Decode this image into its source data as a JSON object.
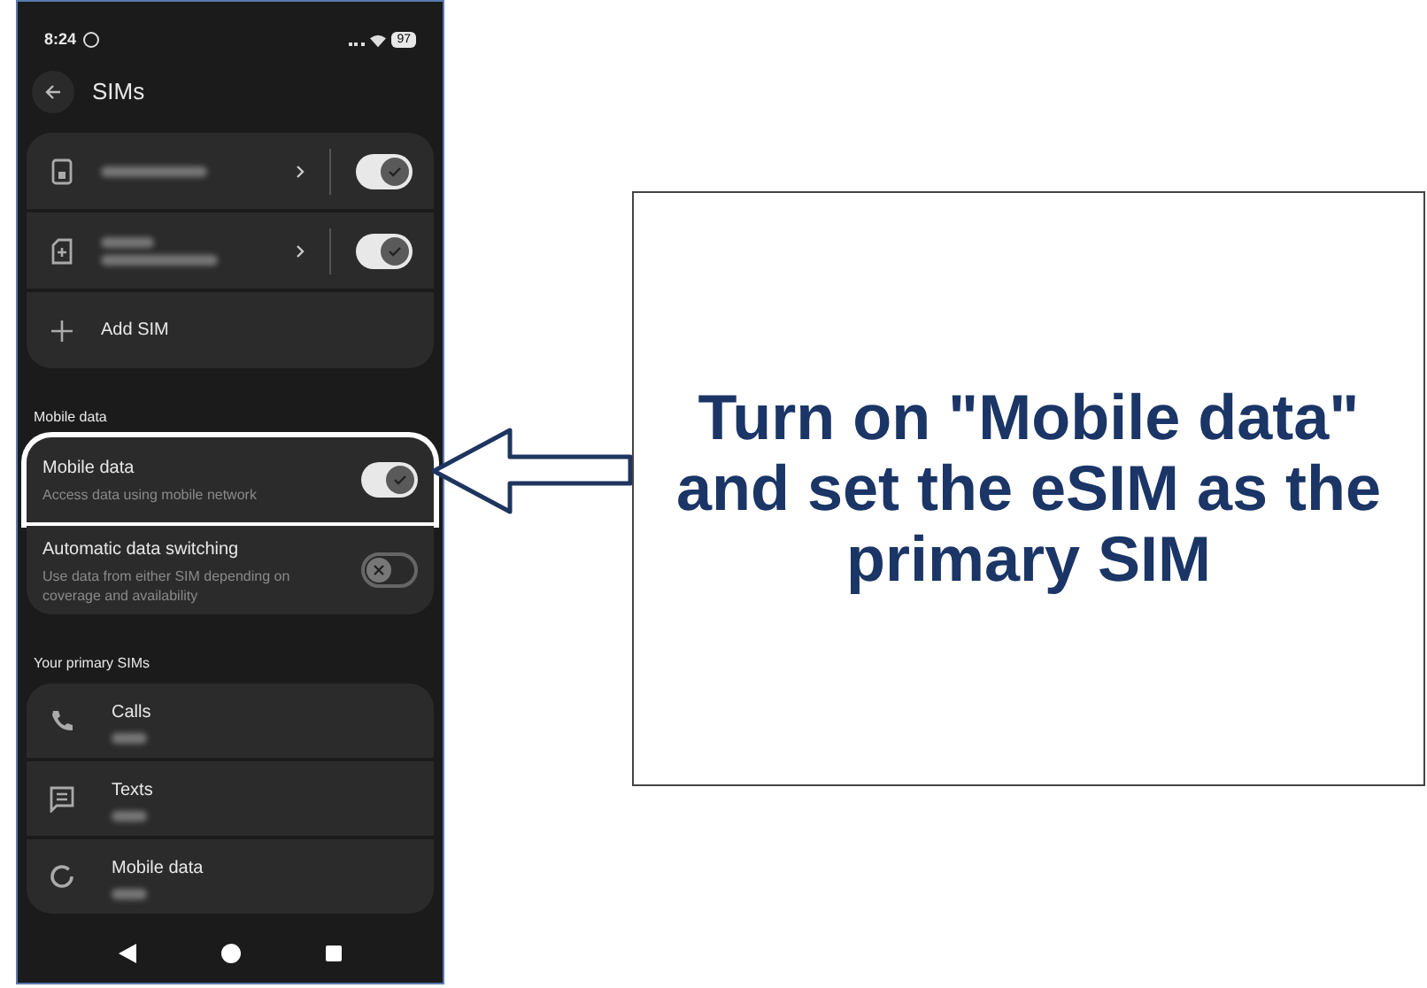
{
  "status_bar": {
    "time": "8:24",
    "battery": "97"
  },
  "header": {
    "title": "SIMs"
  },
  "sims": [
    {
      "kind": "physical",
      "on": true,
      "subtitle": false
    },
    {
      "kind": "esim",
      "on": true,
      "subtitle": true
    },
    {
      "kind": "add",
      "label": "Add SIM"
    }
  ],
  "mobile_data": {
    "heading": "Mobile data",
    "rows": [
      {
        "title": "Mobile data",
        "subtitle": "Access data using mobile network",
        "on": true,
        "highlighted": true
      },
      {
        "title": "Automatic data switching",
        "subtitle": "Use data from either SIM depending on coverage and availability",
        "on": false,
        "highlighted": false
      }
    ]
  },
  "primary_sims": {
    "heading": "Your primary SIMs",
    "items": [
      {
        "kind": "calls",
        "label": "Calls"
      },
      {
        "kind": "texts",
        "label": "Texts"
      },
      {
        "kind": "data",
        "label": "Mobile data"
      }
    ]
  },
  "callout": {
    "text": "Turn on \"Mobile data\" and set the eSIM as the primary SIM"
  }
}
